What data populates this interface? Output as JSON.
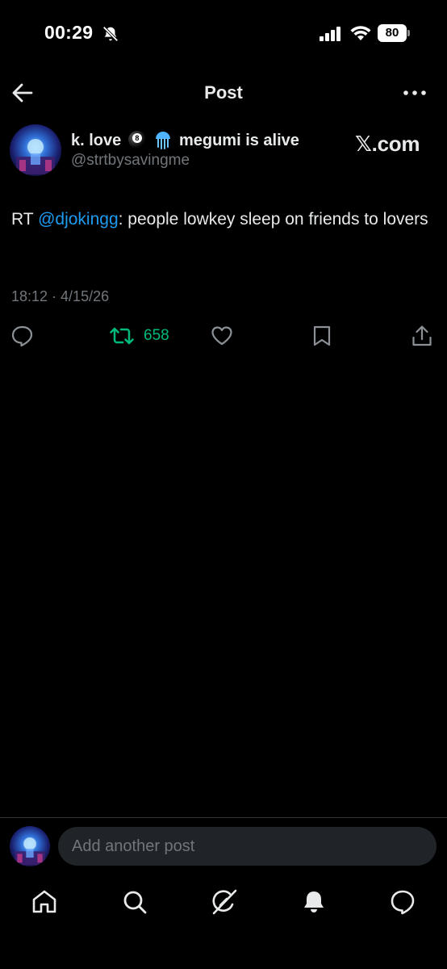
{
  "status_bar": {
    "time": "00:29",
    "battery": "80"
  },
  "header": {
    "title": "Post"
  },
  "author": {
    "name_part1": "k. love",
    "name_part2": "megumi is alive",
    "handle": "@strtbysavingme",
    "source_label": "𝕏.com"
  },
  "post": {
    "prefix": "RT ",
    "mention": "@djokingg",
    "text": ": people lowkey sleep on friends to lovers",
    "meta": "18:12 · 4/15/26"
  },
  "actions": {
    "repost_count": "658"
  },
  "composer": {
    "placeholder": "Add another post"
  },
  "colors": {
    "background": "#000000",
    "text": "#e7e9ea",
    "muted": "#71767b",
    "link": "#1d9bf0",
    "repost": "#00ba7c",
    "input_bg": "#202327"
  },
  "icons": {
    "status": [
      "bell-off-icon",
      "signal-icon",
      "wifi-icon",
      "battery-icon"
    ],
    "header": [
      "back-arrow-icon",
      "more-icon"
    ],
    "actions": [
      "reply-icon",
      "repost-icon",
      "like-icon",
      "bookmark-icon",
      "share-icon"
    ],
    "nav": [
      "home-icon",
      "search-icon",
      "grok-icon",
      "notifications-icon",
      "messages-icon"
    ]
  }
}
